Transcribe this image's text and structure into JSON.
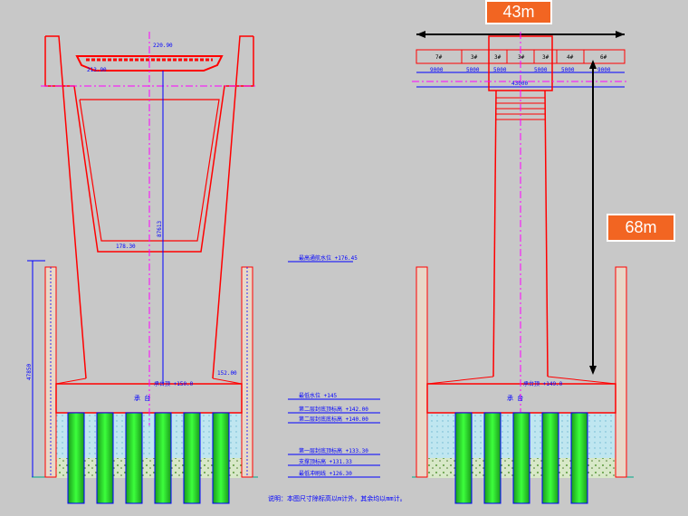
{
  "callouts": {
    "width": "43m",
    "height": "68m"
  },
  "left_view": {
    "top_elev": "220.90",
    "deck_elev": "213.90",
    "beam_elev": "178.30",
    "height_dim": "87613",
    "cap_label": "承台顶 +150.0",
    "side_elev": "152.00",
    "pile_height_dim": "47850",
    "cap_text": "承 台"
  },
  "right_view": {
    "segments": [
      "7#",
      "3#",
      "3#",
      "3#",
      "3#",
      "4#",
      "6#"
    ],
    "sub_dims": [
      "9000",
      "5000",
      "5000",
      "5000",
      "5000",
      "9000"
    ],
    "total_dim": "43000",
    "cap_label": "承台顶 +149.0",
    "cap_text": "承 台"
  },
  "water_levels": [
    {
      "text": "最高通航水位 +176.45"
    },
    {
      "text": "最低水位 +145"
    },
    {
      "text": "第二层封底顶标高 +142.00"
    },
    {
      "text": "第二层封底底标高 +140.00"
    },
    {
      "text": "第一层封底顶标高 +133.30"
    },
    {
      "text": "支撑顶标高 +131.33"
    },
    {
      "text": "最低冲刷线 +126.30"
    }
  ],
  "note": "说明：本图尺寸除标高以m计外，其余均以mm计。",
  "colors": {
    "outline": "#ff0000",
    "centerline": "#ff00ff",
    "dimension": "#0000ff",
    "pile": "#00cc00",
    "callout": "#f26522"
  }
}
